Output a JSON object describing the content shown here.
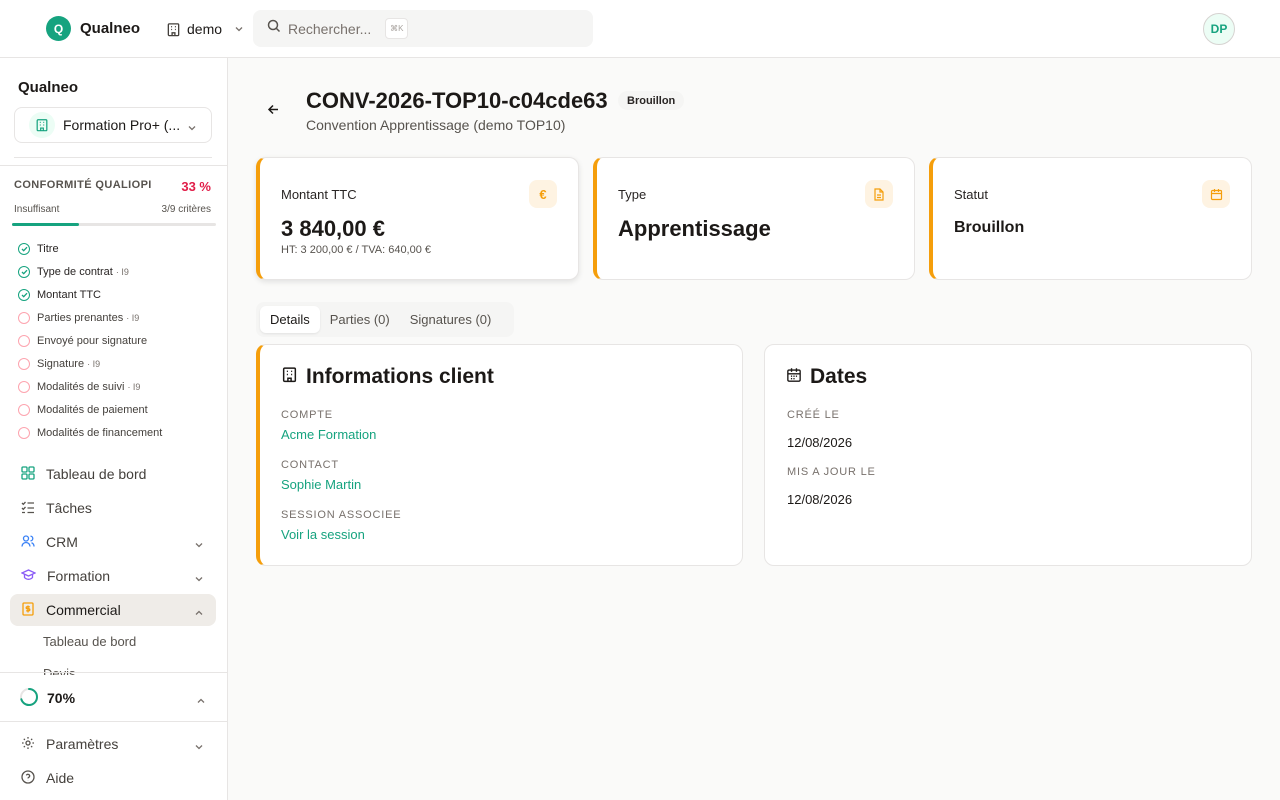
{
  "topbar": {
    "logo_letter": "Q",
    "app_name": "Qualneo",
    "org": "demo",
    "search_placeholder": "Rechercher...",
    "search_shortcut": "⌘K",
    "avatar_initials": "DP"
  },
  "sidebar": {
    "title": "Qualneo",
    "tenant": "Formation Pro+ (...",
    "conformity": {
      "title": "CONFORMITÉ QUALIOPI",
      "percent": "33 %",
      "percent_value": 33,
      "level": "Insuffisant",
      "count": "3/9 critères",
      "criteria": [
        {
          "label": "Titre",
          "tag": "",
          "done": true
        },
        {
          "label": "Type de contrat",
          "tag": "· I9",
          "done": true
        },
        {
          "label": "Montant TTC",
          "tag": "",
          "done": true
        },
        {
          "label": "Parties prenantes",
          "tag": "· I9",
          "done": false
        },
        {
          "label": "Envoyé pour signature",
          "tag": "",
          "done": false
        },
        {
          "label": "Signature",
          "tag": "· I9",
          "done": false
        },
        {
          "label": "Modalités de suivi",
          "tag": "· I9",
          "done": false
        },
        {
          "label": "Modalités de paiement",
          "tag": "",
          "done": false
        },
        {
          "label": "Modalités de financement",
          "tag": "",
          "done": false
        }
      ]
    },
    "nav": {
      "dashboard": "Tableau de bord",
      "tasks": "Tâches",
      "crm": "CRM",
      "training": "Formation",
      "commercial": "Commercial",
      "commercial_sub": [
        "Tableau de bord",
        "Devis"
      ]
    },
    "progress": {
      "label": "70%",
      "value": 70
    },
    "settings": "Paramètres",
    "help": "Aide"
  },
  "header": {
    "title": "CONV-2026-TOP10-c04cde63",
    "badge": "Brouillon",
    "subtitle": "Convention Apprentissage (demo TOP10)"
  },
  "stats": [
    {
      "label": "Montant TTC",
      "value": "3 840,00 €",
      "note": "HT: 3 200,00 € / TVA: 640,00 €",
      "icon": "euro-icon",
      "icon_char": "€"
    },
    {
      "label": "Type",
      "value": "Apprentissage",
      "icon": "document-icon"
    },
    {
      "label": "Statut",
      "value": "Brouillon",
      "icon": "calendar-icon"
    }
  ],
  "tabs": [
    "Details",
    "Parties (0)",
    "Signatures (0)"
  ],
  "client": {
    "title": "Informations client",
    "account_label": "COMPTE",
    "account": "Acme Formation",
    "contact_label": "CONTACT",
    "contact": "Sophie Martin",
    "session_label": "SESSION ASSOCIEE",
    "session": "Voir la session"
  },
  "dates": {
    "title": "Dates",
    "created_label": "CRÉÉ LE",
    "created": "12/08/2026",
    "updated_label": "MIS A JOUR LE",
    "updated": "12/08/2026"
  },
  "colors": {
    "accent": "#16a37f",
    "warning": "#f59e0b",
    "danger": "#e11d48"
  }
}
